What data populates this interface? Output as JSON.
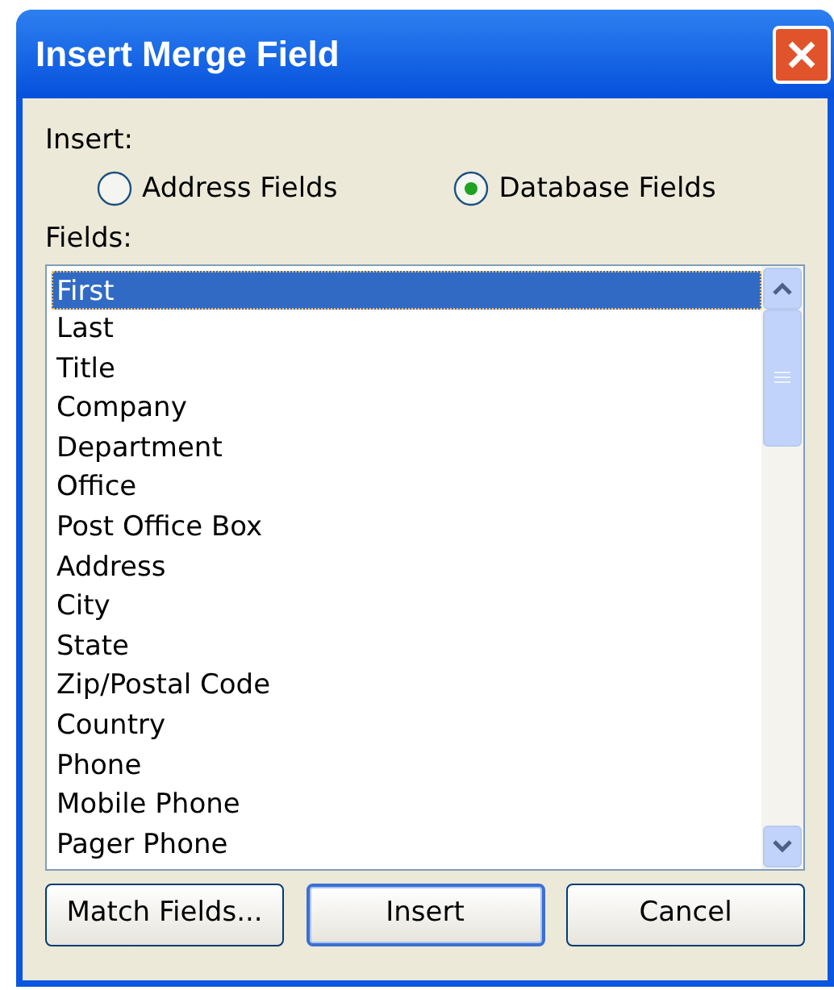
{
  "window": {
    "title": "Insert Merge Field"
  },
  "insert_label": "Insert:",
  "options": [
    {
      "label": "Address Fields",
      "selected": false
    },
    {
      "label": "Database Fields",
      "selected": true
    }
  ],
  "fields_label": "Fields:",
  "fields": [
    {
      "label": "First",
      "selected": true
    },
    {
      "label": "Last",
      "selected": false
    },
    {
      "label": "Title",
      "selected": false
    },
    {
      "label": "Company",
      "selected": false
    },
    {
      "label": "Department",
      "selected": false
    },
    {
      "label": "Office",
      "selected": false
    },
    {
      "label": "Post Office Box",
      "selected": false
    },
    {
      "label": "Address",
      "selected": false
    },
    {
      "label": "City",
      "selected": false
    },
    {
      "label": "State",
      "selected": false
    },
    {
      "label": "Zip/Postal Code",
      "selected": false
    },
    {
      "label": "Country",
      "selected": false
    },
    {
      "label": "Phone",
      "selected": false
    },
    {
      "label": "Mobile Phone",
      "selected": false
    },
    {
      "label": "Pager Phone",
      "selected": false
    }
  ],
  "buttons": [
    {
      "label": "Match Fields...",
      "default": false
    },
    {
      "label": "Insert",
      "default": true
    },
    {
      "label": "Cancel",
      "default": false
    }
  ]
}
